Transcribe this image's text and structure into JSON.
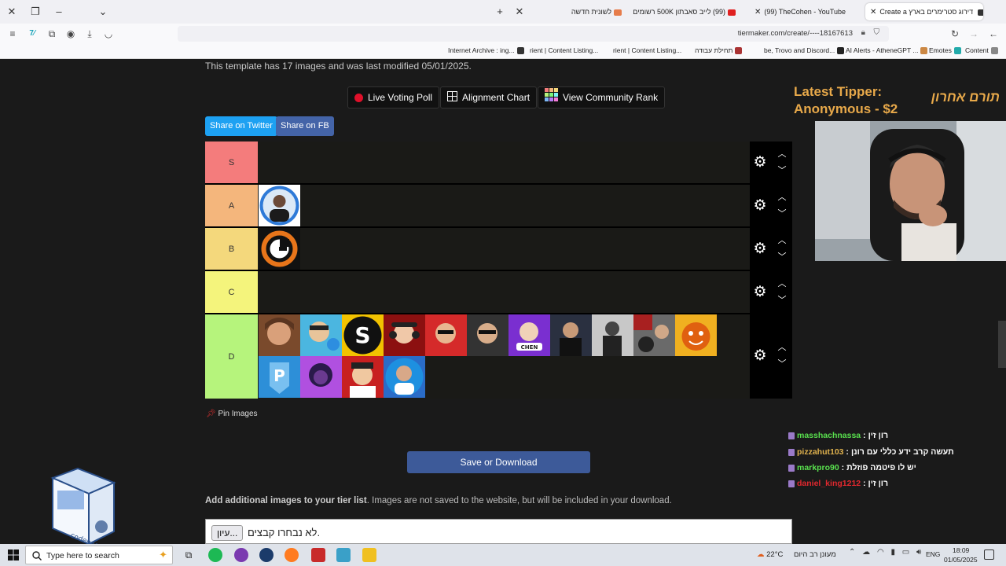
{
  "browser": {
    "tabs": [
      {
        "label": "לשונית חדשה",
        "active": false
      },
      {
        "label": "(99) לייב סאבתון 500K רשומים |",
        "active": false
      },
      {
        "label": "(99) TheCohen - YouTube",
        "active": false
      },
      {
        "label": "Create a דירוג סטרימרים בארץ",
        "active": true
      }
    ],
    "url": "tiermaker.com/create/----18167613",
    "bookmarks": [
      "Content",
      "Emotes",
      "AI Alerts - AtheneGPT ...",
      "be, Trovo and Discord...",
      "תחילת עבודה",
      "rient | Content Listing...",
      "rient | Content Listing...",
      "Internet Archive : ing..."
    ]
  },
  "page": {
    "info_text": "This template has 17 images and was last modified 05/01/2025.",
    "buttons": {
      "live_voting": "Live Voting Poll",
      "alignment": "Alignment Chart",
      "community": "View Community Rank",
      "twitter": "Share on Twitter",
      "fb": "Share on FB"
    },
    "tiers": [
      {
        "label": "S",
        "color": "#f47c7c"
      },
      {
        "label": "A",
        "color": "#f4b67c"
      },
      {
        "label": "B",
        "color": "#f4d87c"
      },
      {
        "label": "C",
        "color": "#f4f47c"
      },
      {
        "label": "D",
        "color": "#b6f47c"
      }
    ],
    "pin_images": "Pin Images",
    "save_download": "Save or Download",
    "add_images_bold": "Add additional images to your tier list",
    "add_images_note": ". Images are not saved to the website, but will be included in your download.",
    "file_button": "עיון...",
    "file_status": "לא נבחרו קבצים."
  },
  "overlay": {
    "tipper_title": "Latest Tipper:",
    "tipper_name": "Anonymous - $2",
    "tipper_hebrew": "תורם אחרון",
    "chat": [
      {
        "user": "masshachnassa",
        "color": "#59e04e",
        "msg": "רון זין"
      },
      {
        "user": "pizzahut103",
        "color": "#e0b24e",
        "msg": "תעשה קרב ידע כללי עם רונן"
      },
      {
        "user": "markpro90",
        "color": "#59e04e",
        "msg": "יש לו פיטמה פוזלת"
      },
      {
        "user": "daniel_king1212",
        "color": "#e0282e",
        "msg": "רון זין"
      }
    ],
    "logo_text": "codebase"
  },
  "taskbar": {
    "search": "Type here to search",
    "temperature": "22°C",
    "weather_desc": "מעונן רב היום",
    "lang": "ENG",
    "time": "18:09",
    "date": "01/05/2025"
  }
}
